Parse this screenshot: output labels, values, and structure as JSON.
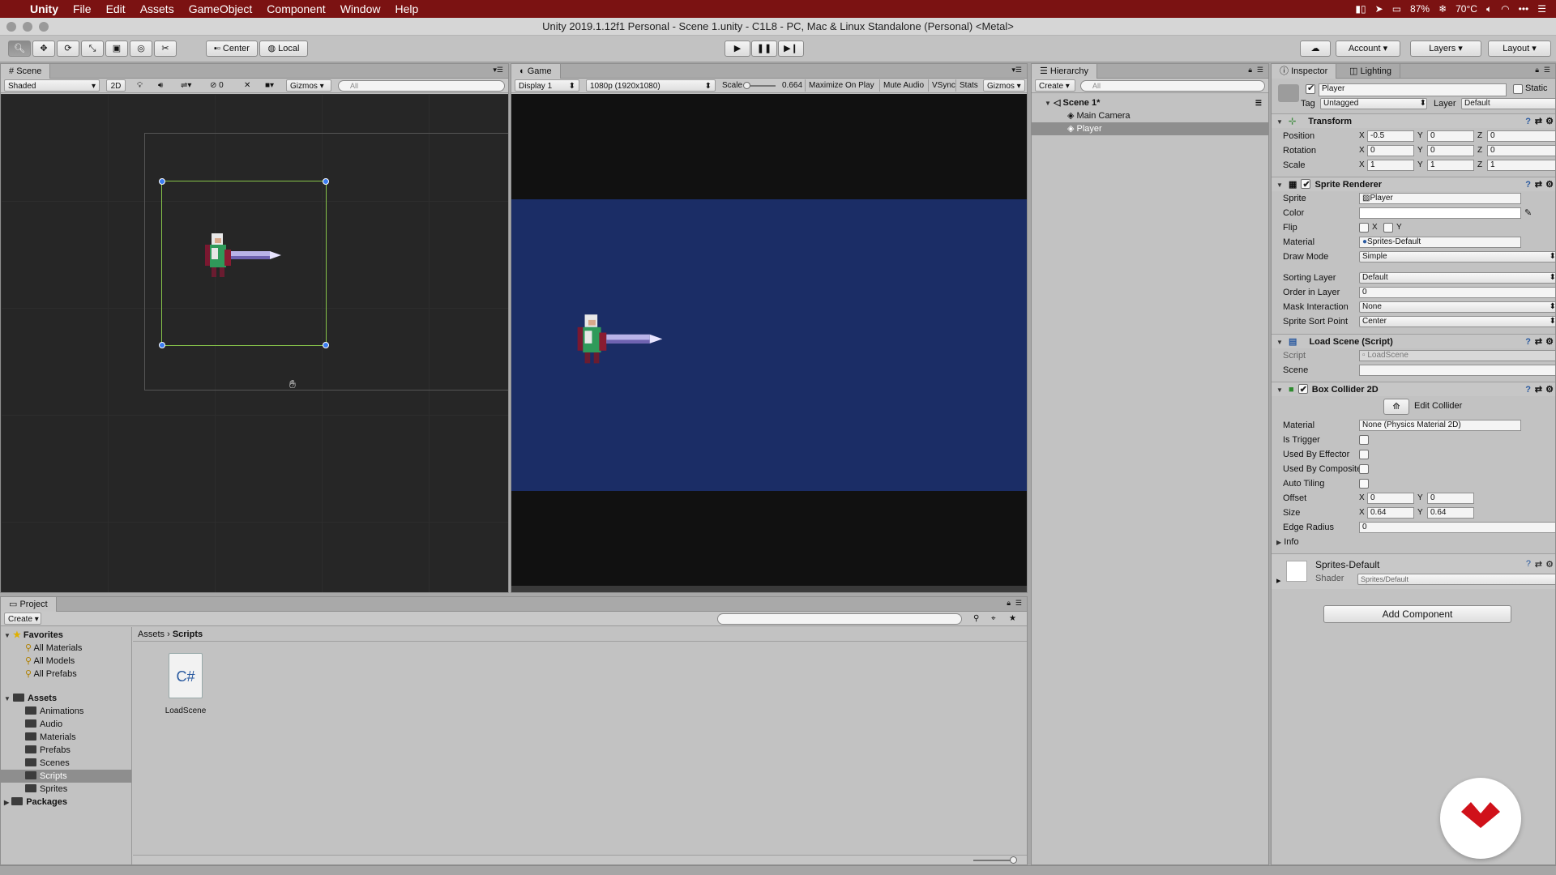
{
  "menubar": {
    "app": "Unity",
    "items": [
      "File",
      "Edit",
      "Assets",
      "GameObject",
      "Component",
      "Window",
      "Help"
    ],
    "battery": "87%",
    "temperature": "70°C"
  },
  "window": {
    "title": "Unity 2019.1.12f1 Personal - Scene 1.unity - C1L8 - PC, Mac & Linux Standalone (Personal) <Metal>"
  },
  "toolbar": {
    "pivot_label": "Center",
    "space_label": "Local",
    "account_label": "Account",
    "layers_label": "Layers",
    "layout_label": "Layout"
  },
  "scene": {
    "tab": "Scene",
    "shading": "Shaded",
    "mode_2d": "2D",
    "hidden_count": "0",
    "gizmos": "Gizmos",
    "search_placeholder": "All"
  },
  "game": {
    "tab": "Game",
    "display": "Display 1",
    "resolution": "1080p (1920x1080)",
    "scale_label": "Scale",
    "scale_value": "0.664",
    "maximize": "Maximize On Play",
    "mute": "Mute Audio",
    "vsync": "VSync",
    "stats": "Stats",
    "gizmos": "Gizmos",
    "background_color": "#1b2d66"
  },
  "hierarchy": {
    "tab": "Hierarchy",
    "create": "Create",
    "search_placeholder": "All",
    "scene_name": "Scene 1*",
    "items": [
      "Main Camera",
      "Player"
    ],
    "selected": "Player"
  },
  "inspector": {
    "tab": "Inspector",
    "tab2": "Lighting",
    "object_name": "Player",
    "static_label": "Static",
    "tag_label": "Tag",
    "tag_value": "Untagged",
    "layer_label": "Layer",
    "layer_value": "Default",
    "transform": {
      "title": "Transform",
      "position_label": "Position",
      "rotation_label": "Rotation",
      "scale_label": "Scale",
      "position": [
        "-0.5",
        "0",
        "0"
      ],
      "rotation": [
        "0",
        "0",
        "0"
      ],
      "scale": [
        "1",
        "1",
        "1"
      ]
    },
    "sprite_renderer": {
      "title": "Sprite Renderer",
      "sprite_label": "Sprite",
      "sprite_value": "Player",
      "color_label": "Color",
      "flip_label": "Flip",
      "flip_x": "X",
      "flip_y": "Y",
      "material_label": "Material",
      "material_value": "Sprites-Default",
      "draw_mode_label": "Draw Mode",
      "draw_mode_value": "Simple",
      "sorting_layer_label": "Sorting Layer",
      "sorting_layer_value": "Default",
      "order_label": "Order in Layer",
      "order_value": "0",
      "mask_label": "Mask Interaction",
      "mask_value": "None",
      "sort_point_label": "Sprite Sort Point",
      "sort_point_value": "Center"
    },
    "load_scene": {
      "title": "Load Scene (Script)",
      "script_label": "Script",
      "script_value": "LoadScene",
      "scene_label": "Scene"
    },
    "box_collider": {
      "title": "Box Collider 2D",
      "edit_collider": "Edit Collider",
      "material_label": "Material",
      "material_value": "None (Physics Material 2D)",
      "is_trigger": "Is Trigger",
      "used_by_effector": "Used By Effector",
      "used_by_composite": "Used By Composite",
      "auto_tiling": "Auto Tiling",
      "offset_label": "Offset",
      "offset": [
        "0",
        "0"
      ],
      "size_label": "Size",
      "size": [
        "0.64",
        "0.64"
      ],
      "edge_radius_label": "Edge Radius",
      "edge_radius": "0",
      "info_label": "Info"
    },
    "material_preview": {
      "name": "Sprites-Default",
      "shader_label": "Shader",
      "shader_value": "Sprites/Default"
    },
    "add_component": "Add Component"
  },
  "project": {
    "tab": "Project",
    "create": "Create",
    "favorites_label": "Favorites",
    "favorites": [
      "All Materials",
      "All Models",
      "All Prefabs"
    ],
    "assets_label": "Assets",
    "folders": [
      "Animations",
      "Audio",
      "Materials",
      "Prefabs",
      "Scenes",
      "Scripts",
      "Sprites"
    ],
    "selected_folder": "Scripts",
    "packages_label": "Packages",
    "breadcrumb": [
      "Assets",
      "Scripts"
    ],
    "files": [
      {
        "name": "LoadScene",
        "glyph": "C#"
      }
    ]
  },
  "axes": {
    "x": "X",
    "y": "Y",
    "z": "Z"
  }
}
